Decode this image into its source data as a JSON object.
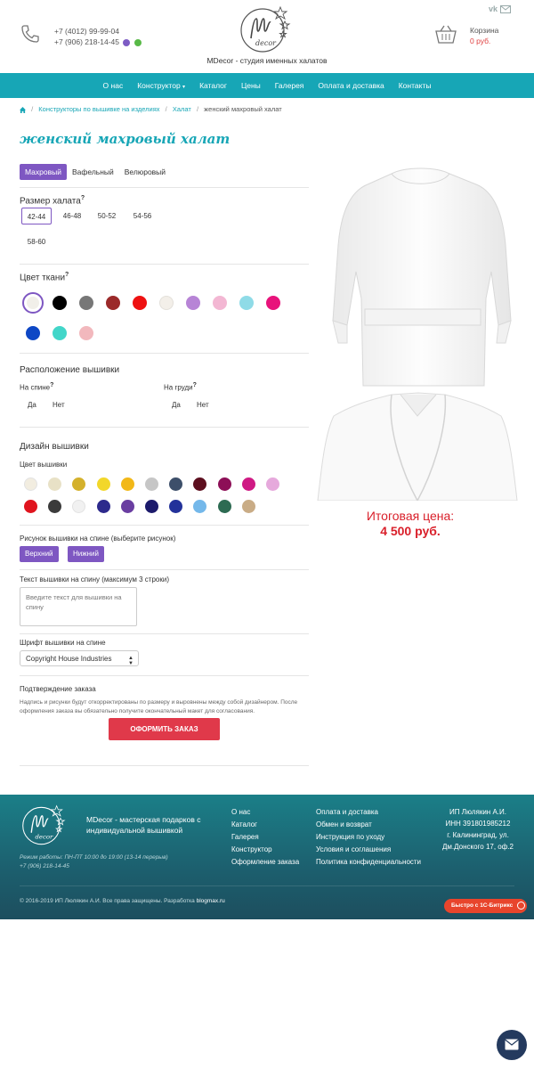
{
  "header": {
    "phone1": "+7 (4012) 99-99-04",
    "phone2": "+7 (906) 218-14-45",
    "tagline": "MDecor - студия именных халатов",
    "cart_label": "Корзина",
    "cart_sum": "0 руб."
  },
  "nav": [
    "О нас",
    "Конструктор",
    "Каталог",
    "Цены",
    "Галерея",
    "Оплата и доставка",
    "Контакты"
  ],
  "breadcrumbs": {
    "c1": "Конструкторы по вышивке на изделиях",
    "c2": "Халат",
    "current": "женский махровый халат"
  },
  "page_title": "женский махровый халат",
  "tabs": [
    "Махровый",
    "Вафельный",
    "Велюровый"
  ],
  "size": {
    "title": "Размер халата",
    "sizes": [
      "42-44",
      "46-48",
      "50-52",
      "54-56",
      "58-60"
    ]
  },
  "fabric": {
    "title": "Цвет ткани",
    "colors": [
      "#f1efe9",
      "#000000",
      "#777777",
      "#9b2a2a",
      "#ee1111",
      "#f3efe9",
      "#b784d6",
      "#f3b7d3",
      "#8fdbe7",
      "#e8137b",
      "#0d47c5",
      "#42d6c9",
      "#f2b8bd"
    ]
  },
  "placement": {
    "title": "Расположение вышивки",
    "back": "На спине",
    "chest": "На груди",
    "yes": "Да",
    "no": "Нет"
  },
  "design": {
    "title": "Дизайн вышивки",
    "color_label": "Цвет вышивки",
    "thread_colors": [
      "#f2ede0",
      "#e8e1c6",
      "#d4b12c",
      "#f2d72a",
      "#f2b818",
      "#c6c6c6",
      "#3d4f6a",
      "#5d0f1f",
      "#8d0f57",
      "#cf1a84",
      "#e6a9dc",
      "#e0141e",
      "#3b3b3b",
      "#f1f1f1",
      "#2d2a8c",
      "#6a3ea1",
      "#1c1a6b",
      "#23329a",
      "#74b8ea",
      "#2d6b52",
      "#c9ac86"
    ],
    "back_picture_label": "Рисунок вышивки на спине (выберите рисунок)",
    "btn_top": "Верхний",
    "btn_bottom": "Нижний",
    "text_label": "Текст вышивки на спину (максимум 3 строки)",
    "text_placeholder": "Введите текст для вышивки на спину",
    "font_label": "Шрифт вышивки на спине",
    "font_value": "Copyright House Industries"
  },
  "confirm": {
    "title": "Подтверждение заказа",
    "text": "Надпись и рисунки будут откорректированы по размеру и выровнены между собой дизайнером. После оформления заказа вы обязательно получите окончательный макет для согласования.",
    "button": "ОФОРМИТЬ ЗАКАЗ"
  },
  "total": {
    "label": "Итоговая цена:",
    "price": "4 500 руб."
  },
  "footer": {
    "desc": "MDecor - мастерская подарков с индивидуальной вышивкой",
    "hours": "Режим работы: ПН-ПТ 10:00 до 19:00 (13-14 перерыв)",
    "phone": "+7 (906) 218-14-45",
    "col1": [
      "О нас",
      "Каталог",
      "Галерея",
      "Конструктор",
      "Оформление заказа"
    ],
    "col2": [
      "Оплата и доставка",
      "Обмен и возврат",
      "Инструкция по уходу",
      "Условия и соглашения",
      "Политика конфиденциальности"
    ],
    "company": "ИП Люлякин А.И.",
    "inn": "ИНН 391801985212",
    "address": "г. Калининград, ул. Дм.Донского 17, оф.2",
    "copyright": "© 2016-2019 ИП Люлякин А.И. Все права защищены. Разработка",
    "dev": "blogmax.ru",
    "bitrix": "Быстро с 1С-Битрикс"
  }
}
